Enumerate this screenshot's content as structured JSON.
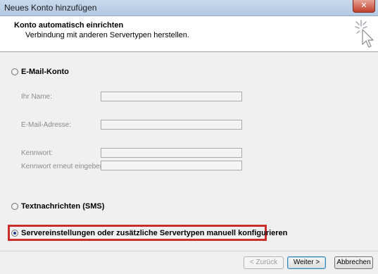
{
  "window": {
    "title": "Neues Konto hinzufügen",
    "close_glyph": "✕"
  },
  "header": {
    "title": "Konto automatisch einrichten",
    "subtitle": "Verbindung mit anderen Servertypen herstellen.",
    "icon": "wizard-cursor-icon"
  },
  "options": {
    "email": {
      "label": "E-Mail-Konto",
      "selected": false
    },
    "sms": {
      "label": "Textnachrichten (SMS)",
      "selected": false
    },
    "manual": {
      "label": "Servereinstellungen oder zusätzliche Servertypen manuell konfigurieren",
      "selected": true
    }
  },
  "form": {
    "name_label": "Ihr Name:",
    "name_value": "",
    "email_label": "E-Mail-Adresse:",
    "email_value": "",
    "password_label": "Kennwort:",
    "password_value": "",
    "password_repeat_label": "Kennwort erneut eingeben:",
    "password_repeat_value": ""
  },
  "buttons": {
    "back": "< Zurück",
    "next": "Weiter >",
    "cancel": "Abbrechen"
  },
  "colors": {
    "highlight": "#c9302c",
    "titlebar": "#c9d9ec",
    "close": "#c1412b"
  }
}
